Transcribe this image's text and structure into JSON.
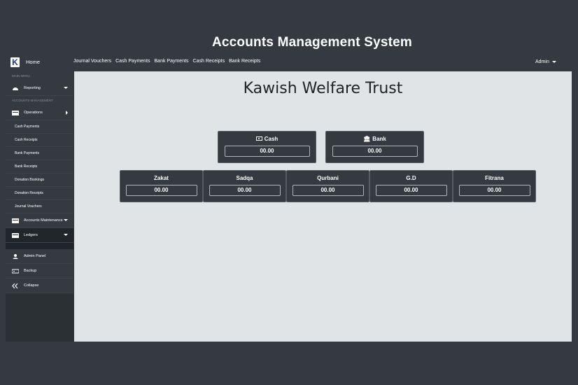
{
  "app": {
    "title": "Accounts Management System",
    "logo_letter": "K"
  },
  "nav": {
    "home": "Home",
    "links": [
      "Journal Vouchers",
      "Cash Payments",
      "Bank Payments",
      "Cash Receipts",
      "Bank Receipts"
    ],
    "user": "Admin"
  },
  "sidebar": {
    "main_menu_heading": "MAIN MENU",
    "reporting": "Reporting",
    "accounts_heading": "ACCOUNTS MANAGEMENT",
    "operations": "Operations",
    "operations_items": [
      "Cash Payments",
      "Cash Receipts",
      "Bank Payments",
      "Bank Receipts",
      "Donation Bookings",
      "Donation Receipts",
      "Journal Vouchers"
    ],
    "accounts_maintenance": "Accounts Maintenance",
    "ledgers": "Ledgers",
    "admin_panel": "Admin Panel",
    "backup": "Backup",
    "collapse": "Collapse"
  },
  "main": {
    "org_title": "Kawish Welfare Trust",
    "cash": {
      "label": "Cash",
      "value": "00.00"
    },
    "bank": {
      "label": "Bank",
      "value": "00.00"
    },
    "funds": [
      {
        "label": "Zakat",
        "value": "00.00"
      },
      {
        "label": "Sadqa",
        "value": "00.00"
      },
      {
        "label": "Qurbani",
        "value": "00.00"
      },
      {
        "label": "G.D",
        "value": "00.00"
      },
      {
        "label": "Fitrana",
        "value": "00.00"
      }
    ]
  },
  "colors": {
    "background": "#343a40",
    "content": "#e1e4e7",
    "sidebar_dark": "#22262a"
  }
}
